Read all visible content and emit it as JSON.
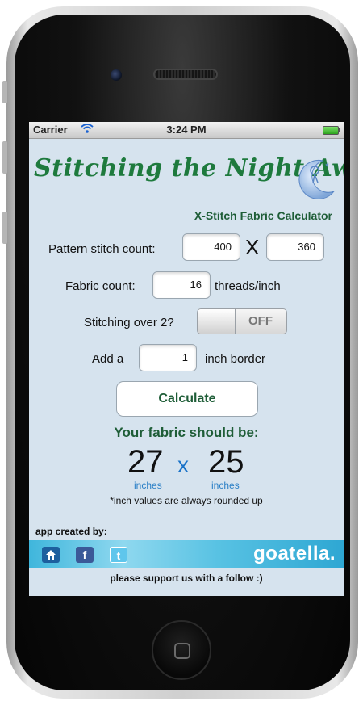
{
  "status_bar": {
    "carrier": "Carrier",
    "time": "3:24 PM"
  },
  "header": {
    "logo_text": "Stitching the Night Away",
    "subtitle": "X-Stitch Fabric Calculator"
  },
  "form": {
    "pattern_label": "Pattern stitch count:",
    "pattern_width": "400",
    "times_symbol": "X",
    "pattern_height": "360",
    "fabric_label": "Fabric count:",
    "fabric_count": "16",
    "fabric_unit": "threads/inch",
    "over2_label": "Stitching over 2?",
    "over2_state": "OFF",
    "border_prefix": "Add a",
    "border_value": "1",
    "border_suffix": "inch border",
    "calculate_label": "Calculate"
  },
  "result": {
    "heading": "Your fabric should be:",
    "width": "27",
    "times": "x",
    "height": "25",
    "width_unit": "inches",
    "height_unit": "inches",
    "note": "*inch values are always rounded up"
  },
  "footer": {
    "credit_label": "app created by:",
    "brand": "goatella.",
    "support_text": "please support us with a follow :)"
  },
  "colors": {
    "screen_bg": "#d6e3ee",
    "accent_green": "#1e5d37",
    "unit_blue": "#2a7fc6",
    "banner_blue": "#3fb6dc"
  }
}
